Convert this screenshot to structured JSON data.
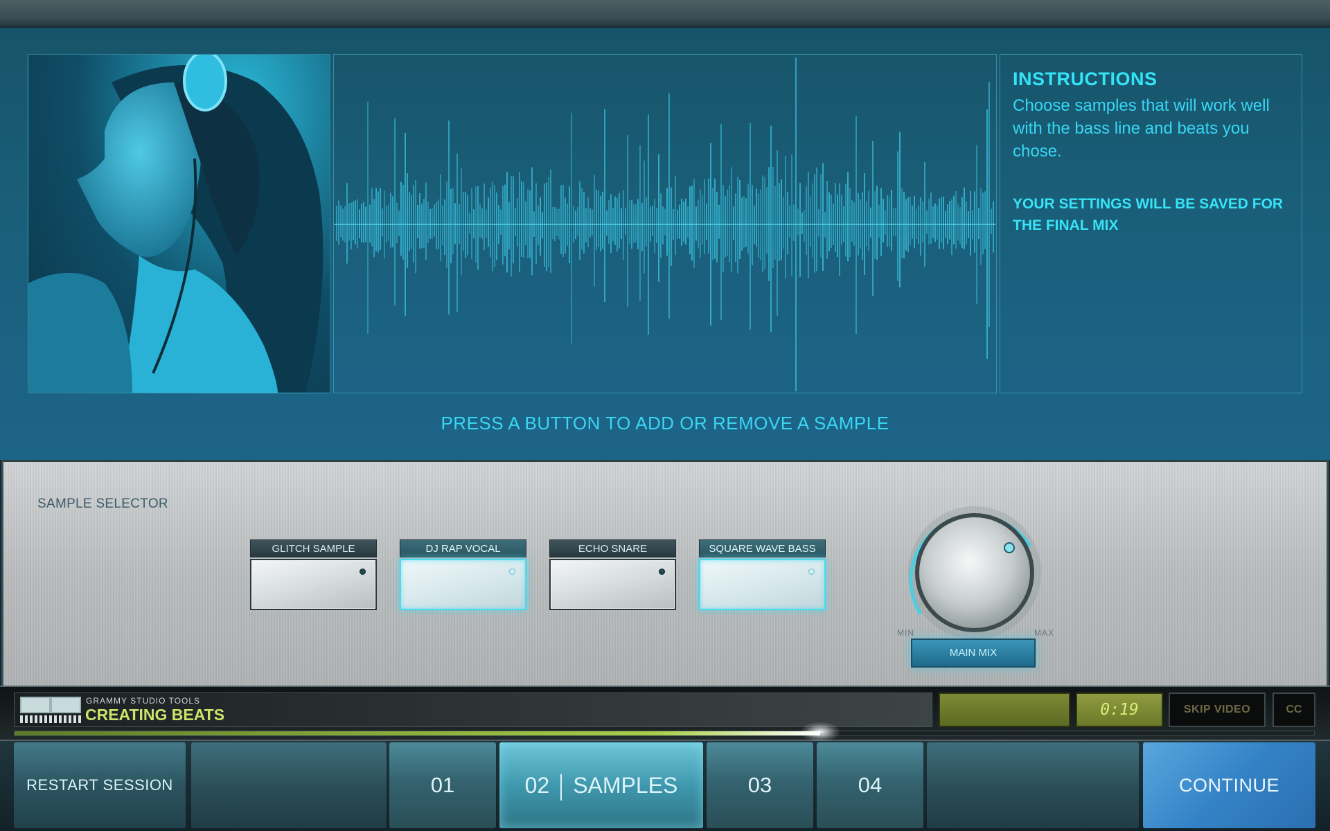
{
  "instructions": {
    "title": "INSTRUCTIONS",
    "body": "Choose samples that will work well with the bass line and beats you chose.",
    "note": "YOUR SETTINGS WILL BE SAVED FOR THE FINAL MIX"
  },
  "prompt": "PRESS A BUTTON TO ADD OR REMOVE A SAMPLE",
  "sample_selector": {
    "title": "SAMPLE SELECTOR",
    "samples": [
      {
        "label": "GLITCH SAMPLE",
        "active": false
      },
      {
        "label": "DJ RAP VOCAL",
        "active": true
      },
      {
        "label": "ECHO SNARE",
        "active": false
      },
      {
        "label": "SQUARE WAVE BASS",
        "active": true
      }
    ],
    "knob": {
      "min_label": "MIN",
      "max_label": "MAX",
      "button_label": "MAIN MIX"
    }
  },
  "player": {
    "subtitle": "GRAMMY STUDIO TOOLS",
    "title": "CREATING BEATS",
    "time": "0:19",
    "skip_label": "SKIP VIDEO",
    "cc_label": "CC",
    "progress": 0.62
  },
  "nav": {
    "restart_label": "RESTART SESSION",
    "steps": [
      {
        "num": "01",
        "label": ""
      },
      {
        "num": "02",
        "label": "SAMPLES"
      },
      {
        "num": "03",
        "label": ""
      },
      {
        "num": "04",
        "label": ""
      }
    ],
    "continue_label": "CONTINUE"
  },
  "colors": {
    "accent_cyan": "#35e3f7",
    "lcd_green": "#cfe36b",
    "continue_blue": "#3483c6"
  }
}
